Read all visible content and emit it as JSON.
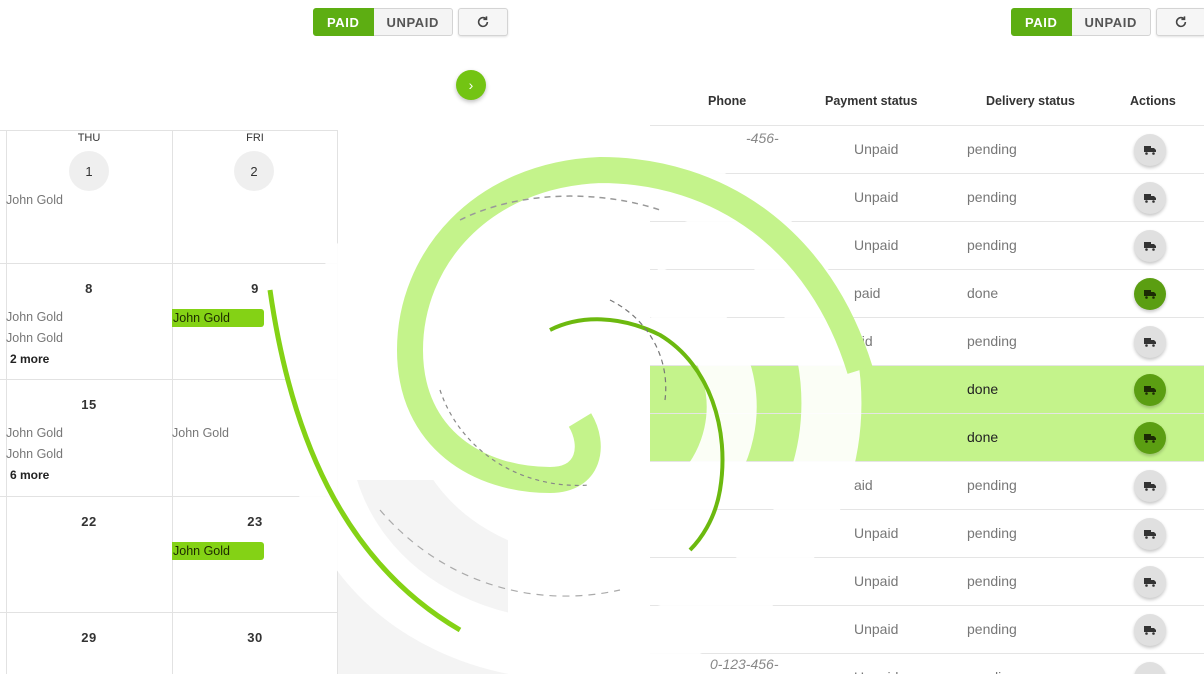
{
  "toolbar_left": {
    "paid_label": "PAID",
    "unpaid_label": "UNPAID",
    "refresh_icon": "refresh-icon"
  },
  "toolbar_right": {
    "paid_label": "PAID",
    "unpaid_label": "UNPAID",
    "refresh_icon": "refresh-icon"
  },
  "colors": {
    "accent": "#5dae12",
    "event_green": "#84d215",
    "highlight_row": "#c4f38b",
    "action_active": "#5b9e12"
  },
  "calendar": {
    "weekdays": [
      "THU",
      "FRI"
    ],
    "week1": {
      "thu": "1",
      "fri": "2",
      "thu_events": [
        "John Gold"
      ]
    },
    "week2": {
      "thu": "8",
      "fri": "9",
      "thu_events": [
        "John Gold",
        "John Gold"
      ],
      "thu_more": "2 more",
      "fri_events": [
        "John Gold"
      ]
    },
    "week3": {
      "thu": "15",
      "thu_events": [
        "John Gold",
        "John Gold"
      ],
      "thu_more": "6 more",
      "fri_events": [
        "John Gold"
      ]
    },
    "week4": {
      "thu": "22",
      "fri": "23",
      "fri_events": [
        "John Gold"
      ]
    },
    "week5": {
      "thu": "29",
      "fri": "30"
    }
  },
  "table": {
    "headers": {
      "phone": "Phone",
      "payment": "Payment status",
      "delivery": "Delivery status",
      "actions": "Actions"
    },
    "phone_fragments": [
      "-456-",
      "0-123-456-"
    ],
    "rows": [
      {
        "payment": "Unpaid",
        "delivery": "pending",
        "action_active": false,
        "highlighted": false
      },
      {
        "payment": "Unpaid",
        "delivery": "pending",
        "action_active": false,
        "highlighted": false
      },
      {
        "payment": "Unpaid",
        "delivery": "pending",
        "action_active": false,
        "highlighted": false
      },
      {
        "payment": "paid",
        "delivery": "done",
        "action_active": true,
        "highlighted": false
      },
      {
        "payment": "aid",
        "delivery": "pending",
        "action_active": false,
        "highlighted": false
      },
      {
        "payment": "",
        "delivery": "done",
        "action_active": true,
        "highlighted": true
      },
      {
        "payment": "",
        "delivery": "done",
        "action_active": true,
        "highlighted": true
      },
      {
        "payment": "aid",
        "delivery": "pending",
        "action_active": false,
        "highlighted": false
      },
      {
        "payment": "Unpaid",
        "delivery": "pending",
        "action_active": false,
        "highlighted": false
      },
      {
        "payment": "Unpaid",
        "delivery": "pending",
        "action_active": false,
        "highlighted": false
      },
      {
        "payment": "Unpaid",
        "delivery": "pending",
        "action_active": false,
        "highlighted": false
      },
      {
        "payment": "Unpaid",
        "delivery": "pending",
        "action_active": false,
        "highlighted": false
      }
    ],
    "action_icon": "truck-icon"
  },
  "expand_icon": "chevron-right-icon"
}
